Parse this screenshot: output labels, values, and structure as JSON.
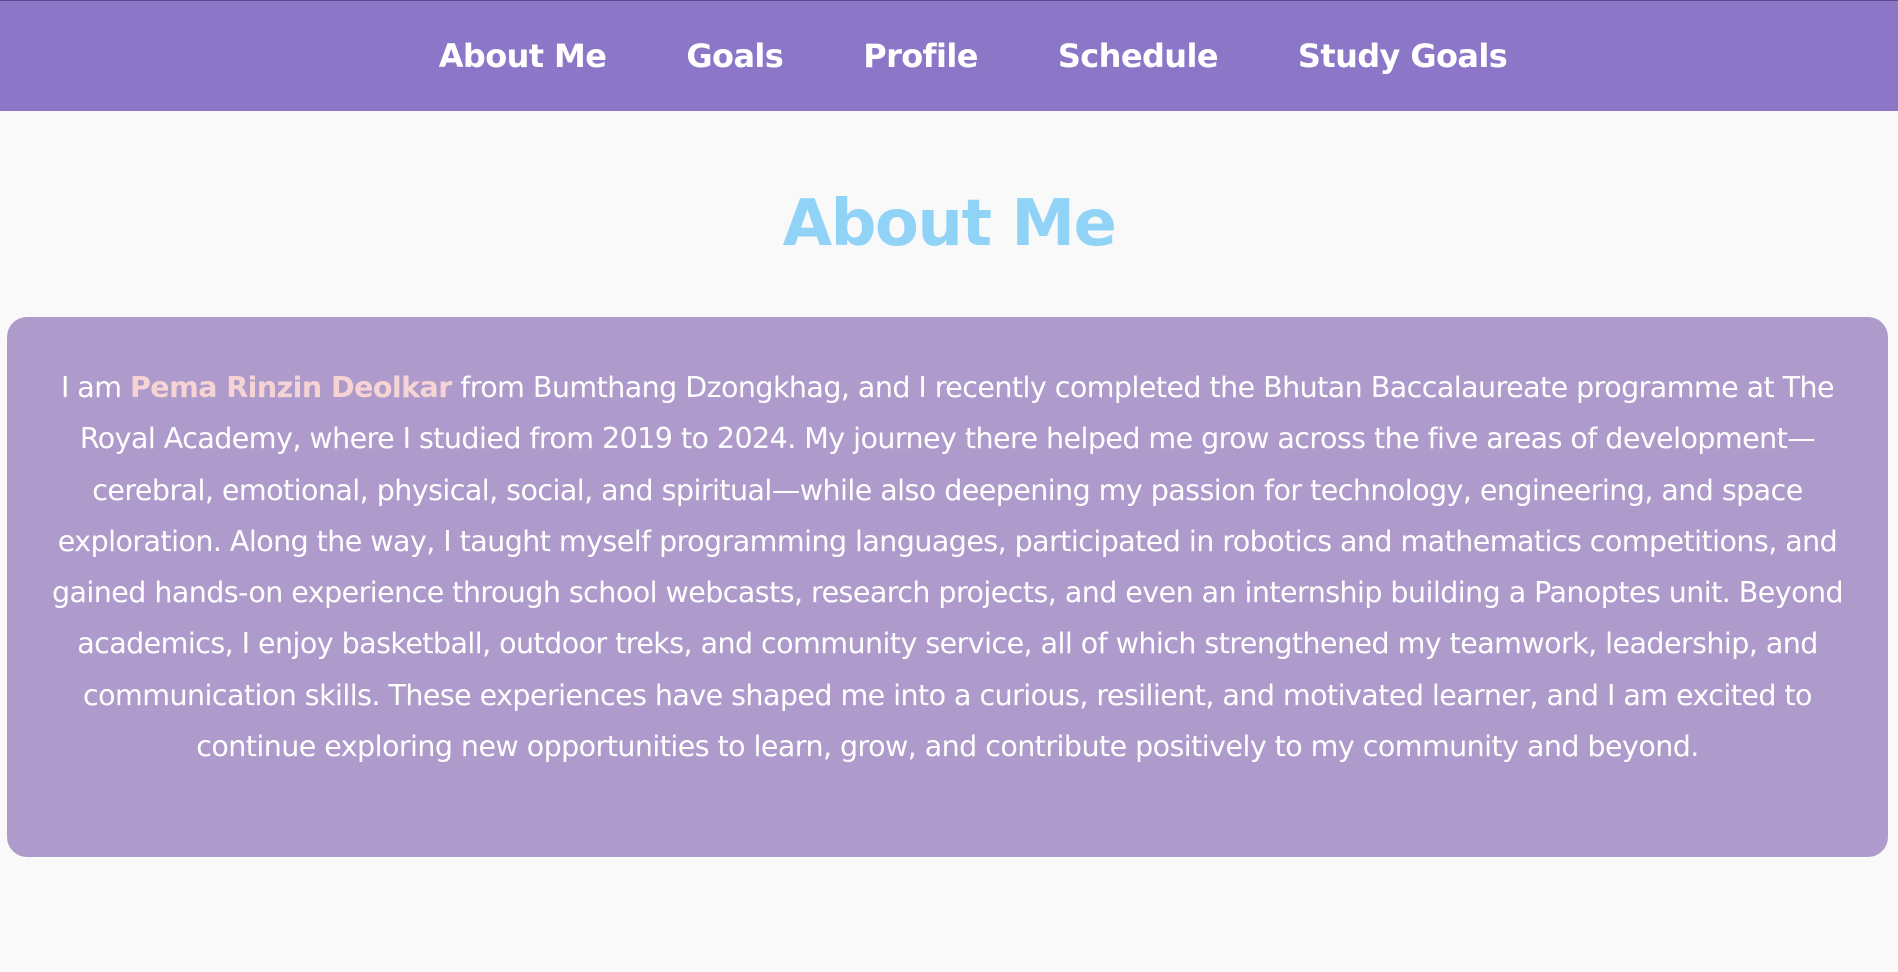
{
  "nav": {
    "items": [
      {
        "label": "About Me"
      },
      {
        "label": "Goals"
      },
      {
        "label": "Profile"
      },
      {
        "label": "Schedule"
      },
      {
        "label": "Study Goals"
      }
    ]
  },
  "main": {
    "title": "About Me",
    "about": {
      "intro": "I am ",
      "name": "Pema Rinzin Deolkar",
      "body": " from Bumthang Dzongkhag, and I recently completed the Bhutan Baccalaureate programme at The Royal Academy, where I studied from 2019 to 2024. My journey there helped me grow across the five areas of development—cerebral, emotional, physical, social, and spiritual—while also deepening my passion for technology, engineering, and space exploration. Along the way, I taught myself programming languages, participated in robotics and mathematics competitions, and gained hands-on experience through school webcasts, research projects, and even an internship building a Panoptes unit. Beyond academics, I enjoy basketball, outdoor treks, and community service, all of which strengthened my teamwork, leadership, and communication skills. These experiences have shaped me into a curious, resilient, and motivated learner, and I am excited to continue exploring new opportunities to learn, grow, and contribute positively to my community and beyond."
    }
  },
  "colors": {
    "nav_background": "#8b76c7",
    "title": "#90d3f6",
    "card_background": "#ae9bcc",
    "name_highlight": "#f6d4d3",
    "page_background": "#f9f9f9"
  }
}
